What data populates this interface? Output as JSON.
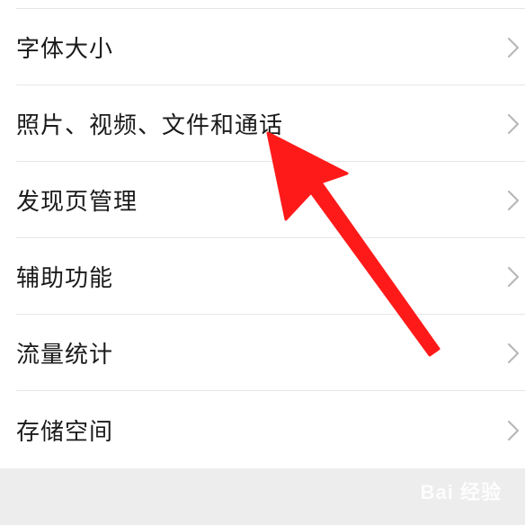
{
  "settings_list": {
    "items": [
      {
        "label": "字体大小"
      },
      {
        "label": "照片、视频、文件和通话"
      },
      {
        "label": "发现页管理"
      },
      {
        "label": "辅助功能"
      },
      {
        "label": "流量统计"
      },
      {
        "label": "存储空间"
      }
    ],
    "chevron_icon": "chevron-right-icon"
  },
  "annotation": {
    "arrow_color": "#ff1a1a",
    "arrow_icon": "red-arrow-annotation"
  },
  "watermark": {
    "text": "Bai 经验"
  }
}
